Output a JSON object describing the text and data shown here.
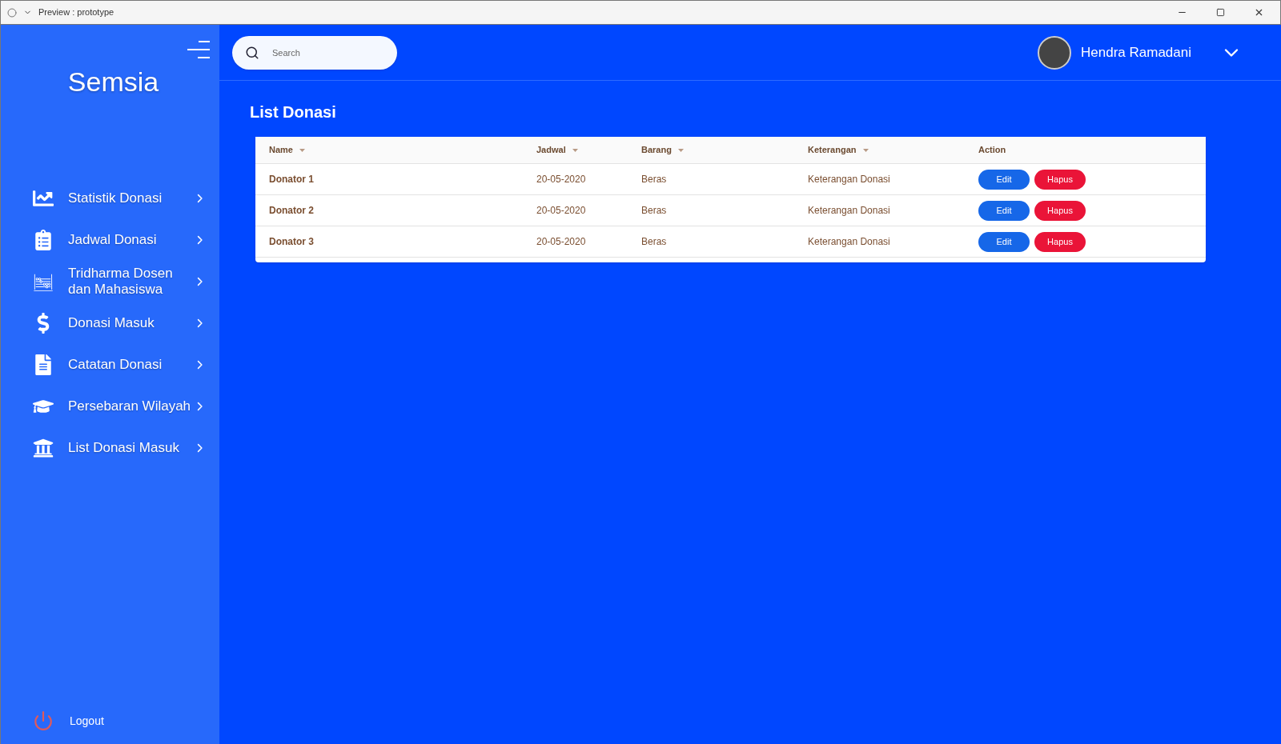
{
  "window": {
    "title": "Preview : prototype"
  },
  "sidebar": {
    "brand": "Semsia",
    "items": [
      {
        "label": "Statistik Donasi"
      },
      {
        "label": "Jadwal Donasi"
      },
      {
        "label": "Tridharma Dosen dan Mahasiswa"
      },
      {
        "label": "Donasi Masuk"
      },
      {
        "label": "Catatan Donasi"
      },
      {
        "label": "Persebaran Wilayah"
      },
      {
        "label": "List Donasi Masuk"
      }
    ],
    "logout": "Logout"
  },
  "header": {
    "search": {
      "placeholder": "Search"
    },
    "user": {
      "name": "Hendra Ramadani"
    }
  },
  "page": {
    "title": "List Donasi"
  },
  "table": {
    "columns": [
      {
        "label": "Name",
        "sortable": true
      },
      {
        "label": "Jadwal",
        "sortable": true
      },
      {
        "label": "Barang",
        "sortable": true
      },
      {
        "label": "Keterangan",
        "sortable": true
      },
      {
        "label": "Action",
        "sortable": false
      }
    ],
    "rows": [
      {
        "name": "Donator 1",
        "jadwal": "20-05-2020",
        "barang": "Beras",
        "keterangan": "Keterangan Donasi",
        "actions": [
          "Edit",
          "Hapus"
        ]
      },
      {
        "name": "Donator 2",
        "jadwal": "20-05-2020",
        "barang": "Beras",
        "keterangan": "Keterangan Donasi",
        "actions": [
          "Edit",
          "Hapus"
        ]
      },
      {
        "name": "Donator 3",
        "jadwal": "20-05-2020",
        "barang": "Beras",
        "keterangan": "Keterangan Donasi",
        "actions": [
          "Edit",
          "Hapus"
        ]
      }
    ]
  }
}
